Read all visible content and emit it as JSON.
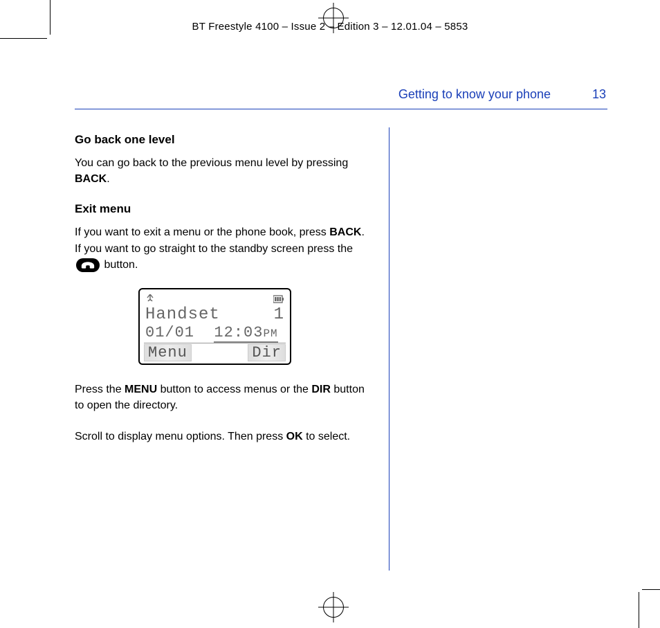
{
  "header": "BT Freestyle 4100 – Issue 2 – Edition 3 – 12.01.04 – 5853",
  "section_title": "Getting to know your phone",
  "page_number": "13",
  "sub1_title": "Go back one level",
  "sub1_p_a": "You can go back to the previous menu level by pressing ",
  "sub1_p_b": "BACK",
  "sub1_p_c": ".",
  "sub2_title": "Exit menu",
  "sub2_p_a": "If you want to exit a menu or the phone book, press ",
  "sub2_p_b": "BACK",
  "sub2_p_c": ".  If you want to go straight to the standby screen press the ",
  "sub2_p_d": " button.",
  "lcd": {
    "handset_label": "Handset",
    "handset_num": "1",
    "date": "01/01",
    "time": "12:03",
    "ampm": "PM",
    "soft_left": "Menu",
    "soft_right": "Dir"
  },
  "p3_a": "Press the ",
  "p3_b": "MENU",
  "p3_c": "  button to access menus or the ",
  "p3_d": "DIR",
  "p3_e": " button to open the directory.",
  "p4_a": "Scroll to display menu options. Then press ",
  "p4_b": "OK",
  "p4_c": " to select."
}
